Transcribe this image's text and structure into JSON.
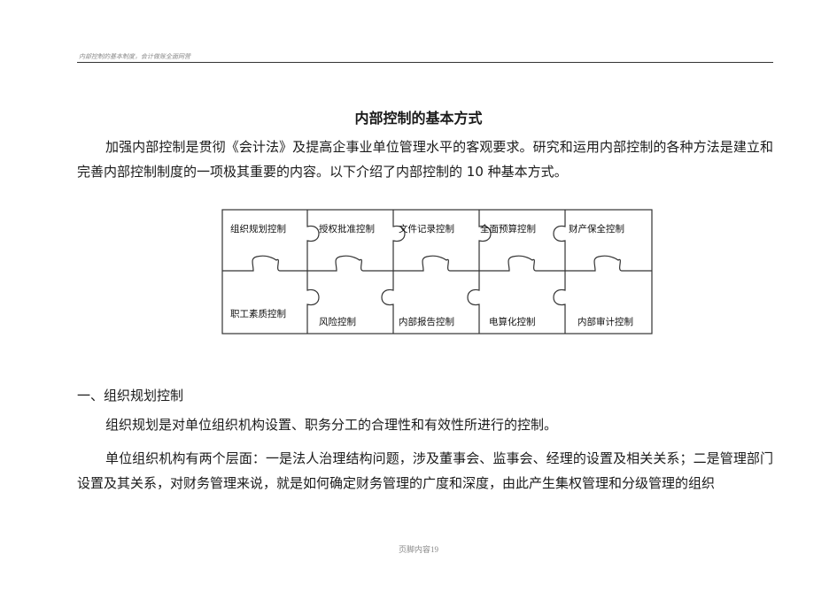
{
  "header": {
    "text": "内部控制的基本制度，会计做账全面网营"
  },
  "title": "内部控制的基本方式",
  "intro_paragraph": "加强内部控制是贯彻《会计法》及提高企事业单位管理水平的客观要求。研究和运用内部控制的各种方法是建立和完善内部控制制度的一项极其重要的内容。以下介绍了内部控制的 10 种基本方式。",
  "puzzle": {
    "top_row": [
      "组织规划控制",
      "授权批准控制",
      "文件记录控制",
      "全面预算控制",
      "财产保全控制"
    ],
    "bottom_row": [
      "职工素质控制",
      "风险控制",
      "内部报告控制",
      "电算化控制",
      "内部审计控制"
    ]
  },
  "section1": {
    "heading": "一、组织规划控制",
    "para1": "组织规划是对单位组织机构设置、职务分工的合理性和有效性所进行的控制。",
    "para2": "单位组织机构有两个层面：一是法人治理结构问题，涉及董事会、监事会、经理的设置及相关关系；二是管理部门设置及其关系，对财务管理来说，就是如何确定财务管理的广度和深度，由此产生集权管理和分级管理的组织"
  },
  "footer": {
    "text": "页脚内容19"
  }
}
